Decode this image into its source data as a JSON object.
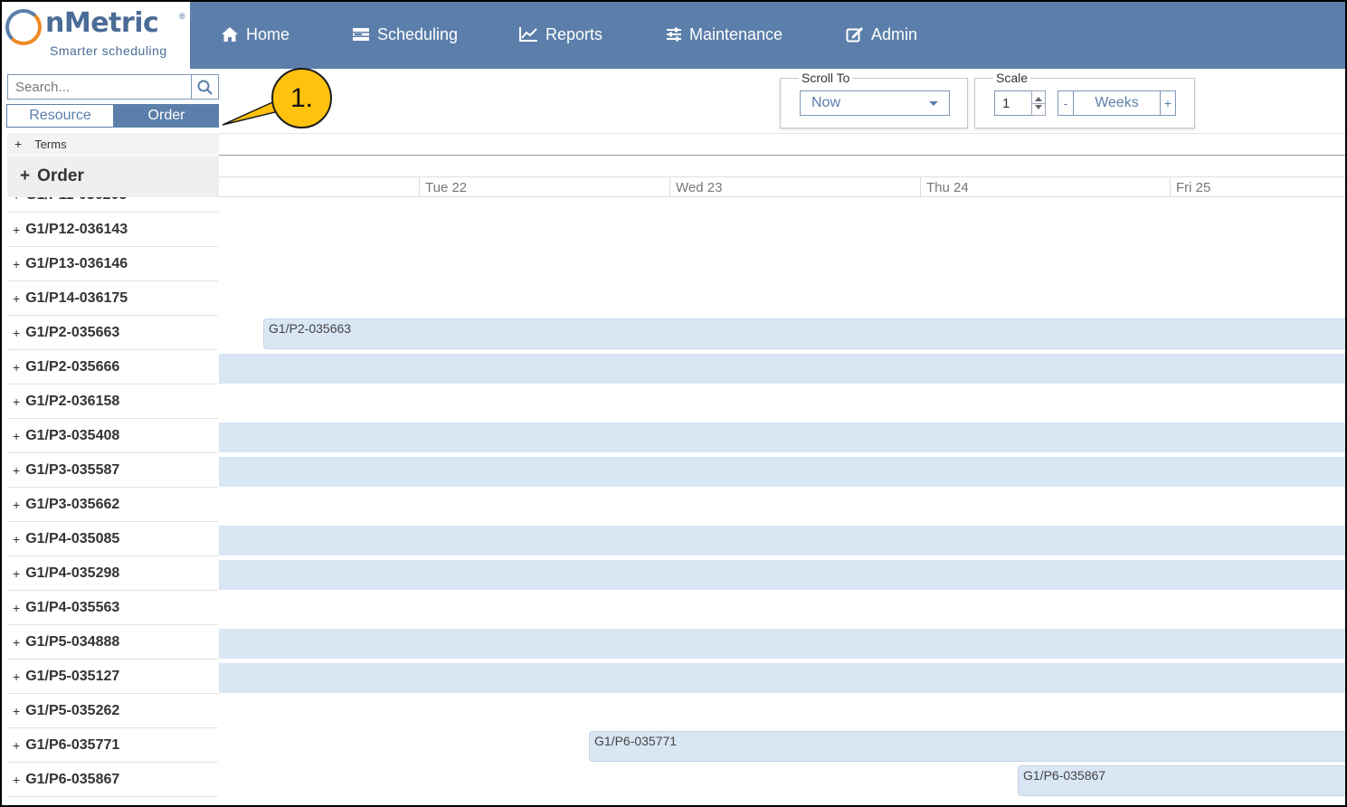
{
  "brand": {
    "name": "nMetric",
    "tagline": "Smarter scheduling",
    "registered": "®"
  },
  "nav": [
    {
      "label": "Home",
      "icon": "home-icon"
    },
    {
      "label": "Scheduling",
      "icon": "scheduling-icon"
    },
    {
      "label": "Reports",
      "icon": "chart-icon"
    },
    {
      "label": "Maintenance",
      "icon": "sliders-icon"
    },
    {
      "label": "Admin",
      "icon": "edit-icon"
    }
  ],
  "search": {
    "placeholder": "Search..."
  },
  "view_toggle": {
    "resource": "Resource",
    "order": "Order",
    "active": "Order"
  },
  "terms": {
    "plus": "+",
    "label": "Terms"
  },
  "order_group": {
    "plus": "+",
    "label": "Order"
  },
  "orders": [
    "G1/P11-036205",
    "G1/P12-036143",
    "G1/P13-036146",
    "G1/P14-036175",
    "G1/P2-035663",
    "G1/P2-035666",
    "G1/P2-036158",
    "G1/P3-035408",
    "G1/P3-035587",
    "G1/P3-035662",
    "G1/P4-035085",
    "G1/P4-035298",
    "G1/P4-035563",
    "G1/P5-034888",
    "G1/P5-035127",
    "G1/P5-035262",
    "G1/P6-035771",
    "G1/P6-035867"
  ],
  "scroll_to": {
    "legend": "Scroll To",
    "value": "Now"
  },
  "scale": {
    "legend": "Scale",
    "value": "1",
    "minus": "-",
    "unit": "Weeks",
    "plus": "+"
  },
  "timeline": {
    "days": [
      "Tue 22",
      "Wed 23",
      "Thu 24",
      "Fri 25"
    ],
    "bars": [
      {
        "label": "G1/P2-035663"
      },
      {
        "label": "G1/P6-035771"
      },
      {
        "label": "G1/P6-035867"
      }
    ]
  },
  "callout": {
    "label": "1."
  },
  "colors": {
    "header": "#5b7faa",
    "accent": "#5b7faa",
    "band": "#d9e6f4",
    "callout": "#ffc20e",
    "logo_orange": "#f08a24"
  }
}
